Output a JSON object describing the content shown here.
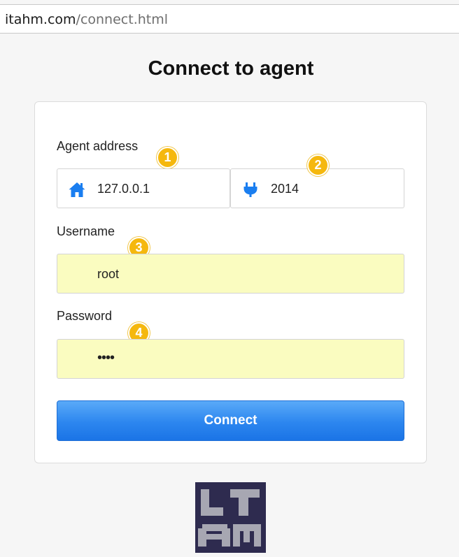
{
  "browser": {
    "url_host": "itahm.com",
    "url_path": "/connect.html"
  },
  "page": {
    "title": "Connect to agent"
  },
  "form": {
    "agent_address_label": "Agent address",
    "address_value": "127.0.0.1",
    "port_value": "2014",
    "username_label": "Username",
    "username_value": "root",
    "password_label": "Password",
    "password_value": "••••",
    "connect_label": "Connect"
  },
  "badges": [
    "1",
    "2",
    "3",
    "4"
  ],
  "icons": {
    "address": "home-icon",
    "port": "plug-icon",
    "logo": "itahm-logo"
  },
  "colors": {
    "accent": "#2c86ef",
    "badge": "#f5b80e",
    "autofill": "#fafcc0",
    "logo_bg": "#2e2b4f",
    "logo_fg": "#a7a7b2"
  }
}
